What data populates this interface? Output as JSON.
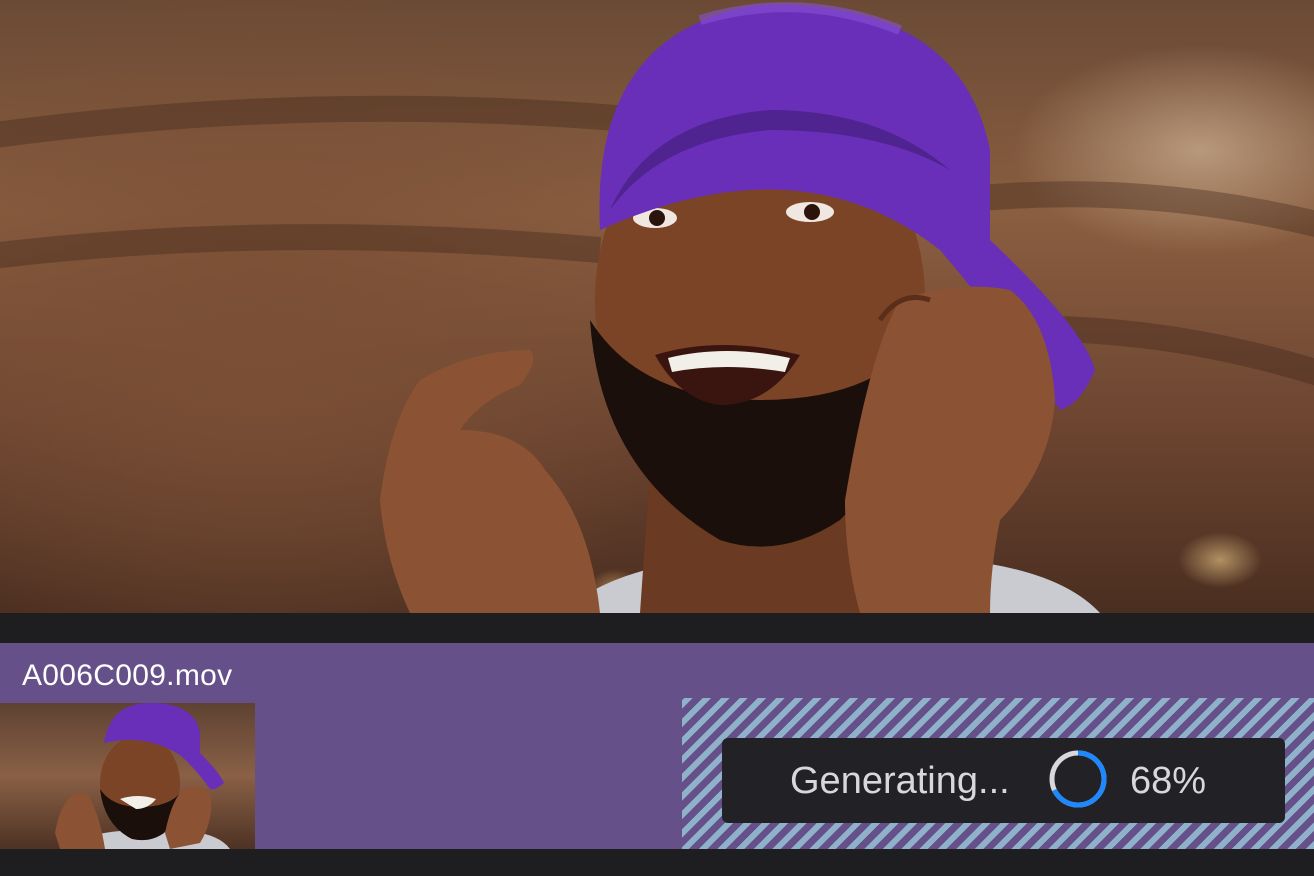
{
  "clip": {
    "filename": "A006C009.mov"
  },
  "generation": {
    "status_label": "Generating...",
    "progress_text": "68%",
    "progress": 0.68
  },
  "colors": {
    "clip_track": "#66508a",
    "stripe": "#8fb1c9",
    "progress_ring": "#1e88ff",
    "panel_bg": "#222226"
  }
}
